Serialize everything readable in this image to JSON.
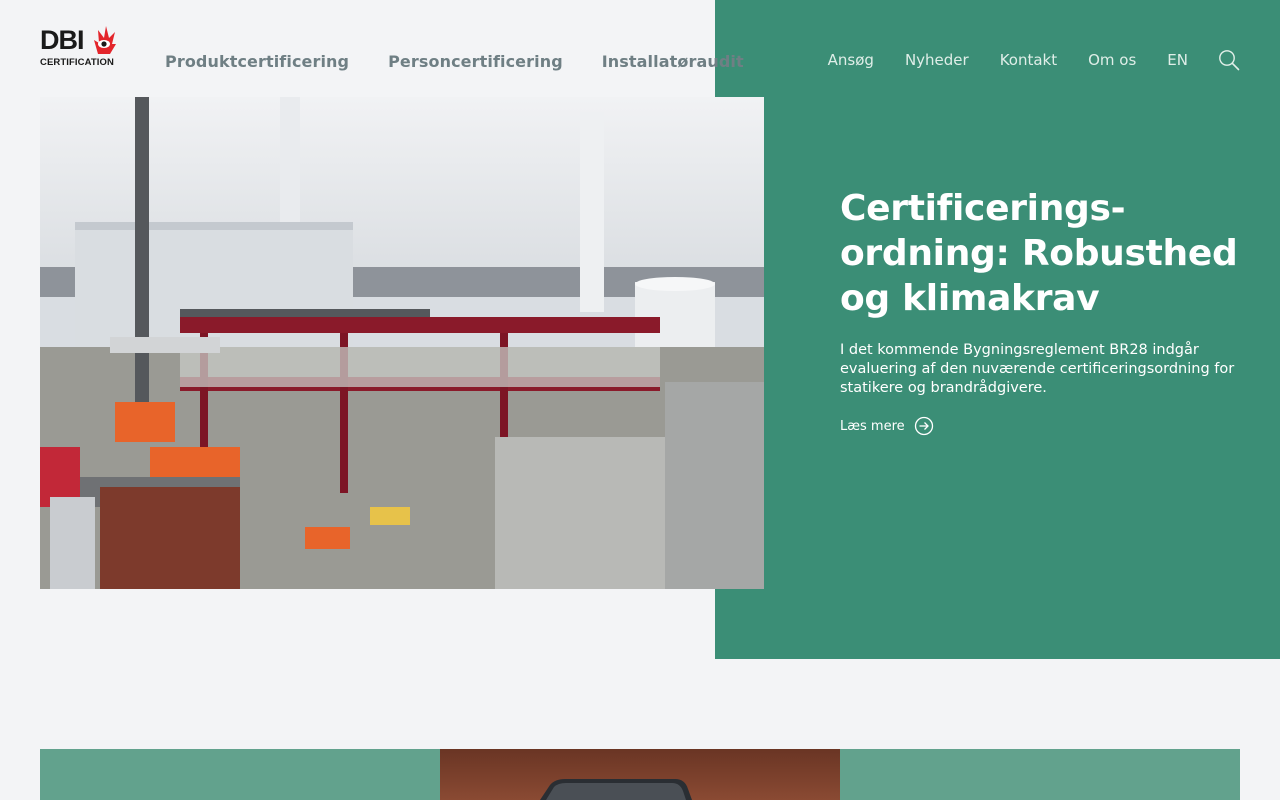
{
  "logo": {
    "name": "DBI",
    "subtitle": "CERTIFICATION"
  },
  "main_nav": [
    "Produktcertificering",
    "Personcertificering",
    "Installatøraudit"
  ],
  "util_nav": [
    "Ansøg",
    "Nyheder",
    "Kontakt",
    "Om os",
    "EN"
  ],
  "icons": {
    "search": "search-icon",
    "read_more_arrow": "arrow-circle-right-icon",
    "logo_mark": "flame-eye-icon"
  },
  "hero": {
    "title": "Certificerings-ordning: Robusthed og klimakrav",
    "description": "I det kommende Bygningsreglement BR28 indgår evaluering af den nuværende certificeringsordning for statikere og brandrådgivere.",
    "read_more": "Læs mere"
  },
  "colors": {
    "accent_green": "#3b8e76",
    "page_bg": "#f3f4f6",
    "logo_red": "#e3252b"
  }
}
